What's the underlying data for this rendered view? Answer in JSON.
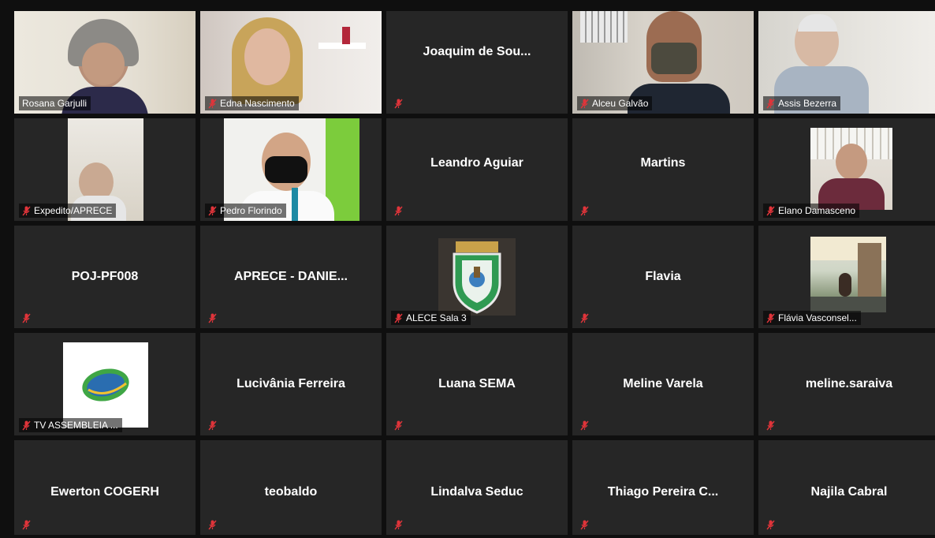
{
  "participants": [
    {
      "name": "Rosana Garjulli"
    },
    {
      "name": "Edna Nascimento"
    },
    {
      "name": "Joaquim de Sou..."
    },
    {
      "name": "Alceu Galvão"
    },
    {
      "name": "Assis Bezerra"
    },
    {
      "name": "Expedito/APRECE"
    },
    {
      "name": "Pedro Florindo"
    },
    {
      "name": "Leandro Aguiar"
    },
    {
      "name": "Martins"
    },
    {
      "name": "Elano Damasceno"
    },
    {
      "name": "POJ-PF008"
    },
    {
      "name": "APRECE - DANIE..."
    },
    {
      "name": "ALECE Sala 3"
    },
    {
      "name": "Flavia"
    },
    {
      "name": "Flávia Vasconsel..."
    },
    {
      "name": "TV ASSEMBLEIA ..."
    },
    {
      "name": "Lucivânia Ferreira"
    },
    {
      "name": "Luana SEMA"
    },
    {
      "name": "Meline Varela"
    },
    {
      "name": "meline.saraiva"
    },
    {
      "name": "Ewerton COGERH"
    },
    {
      "name": "teobaldo"
    },
    {
      "name": "Lindalva Seduc"
    },
    {
      "name": "Thiago Pereira C..."
    },
    {
      "name": "Najila Cabral"
    }
  ],
  "colors": {
    "active_speaker": "#d8e14a",
    "tile_bg": "#262626",
    "muted_icon": "#e0343a"
  }
}
